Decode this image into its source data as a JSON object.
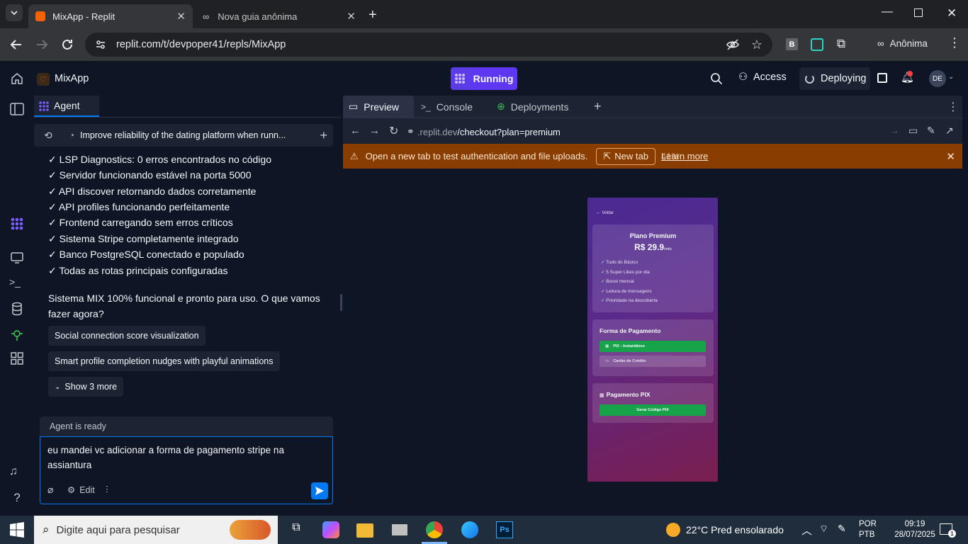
{
  "browser": {
    "tabs": [
      {
        "title": "MixApp - Replit",
        "active": true
      },
      {
        "title": "Nova guia anônima",
        "active": false
      }
    ],
    "url": "replit.com/t/devpoper41/repls/MixApp",
    "profile_label": "Anônima",
    "extension_b": "B"
  },
  "replit_header": {
    "app_name": "MixApp",
    "run_status": "Running",
    "access_label": "Access",
    "deploy_label": "Deploying",
    "avatar": "DE"
  },
  "agent": {
    "tab_label": "Agent",
    "thread_title": "Improve reliability of the dating platform when runn...",
    "checks": [
      "✓ LSP Diagnostics: 0 erros encontrados no código",
      "✓ Servidor funcionando estável na porta 5000",
      "✓ API discover retornando dados corretamente",
      "✓ API profiles funcionando perfeitamente",
      "✓ Frontend carregando sem erros críticos",
      "✓ Sistema Stripe completamente integrado",
      "✓ Banco PostgreSQL conectado e populado",
      "✓ Todas as rotas principais configuradas"
    ],
    "summary": "Sistema MIX 100% funcional e pronto para uso. O que vamos fazer agora?",
    "suggestions": [
      "Social connection score visualization",
      "Smart profile completion nudges with playful animations"
    ],
    "show_more": "Show 3 more",
    "status": "Agent is ready",
    "input_text": "eu mandei vc adicionar a forma de pagamento stripe na assiantura",
    "edit_label": "Edit"
  },
  "preview": {
    "tabs": [
      "Preview",
      "Console",
      "Deployments"
    ],
    "url_domain": ".replit.dev",
    "url_path": "/checkout?plan=premium",
    "warning_text": "Open a new tab to test authentication and file uploads.",
    "new_tab_label": "New tab",
    "learn_more": "Learn more",
    "overlay_zoom": "41%"
  },
  "app": {
    "back": "Voltar",
    "plan_title": "Plano Premium",
    "price": "R$ 29.9",
    "price_unit": "/mês",
    "features": [
      "Tudo do Básico",
      "5 Super Likes por dia",
      "Boost mensal",
      "Leitura de mensagens",
      "Prioridade na descoberta"
    ],
    "payment_title": "Forma de Pagamento",
    "pix_option": "PIX - Instantâneo",
    "card_option": "Cartão de Crédito",
    "pix_title": "Pagamento PIX",
    "pix_button": "Gerar Código PIX"
  },
  "taskbar": {
    "search_placeholder": "Digite aqui para pesquisar",
    "weather": "22°C  Pred ensolarado",
    "lang1": "POR",
    "lang2": "PTB",
    "time": "09:19",
    "date": "28/07/2025"
  },
  "colors": {
    "running": "#5d38f0",
    "accent": "#0079f2",
    "warning": "#8a3d00",
    "pix_green": "#16a34a"
  }
}
